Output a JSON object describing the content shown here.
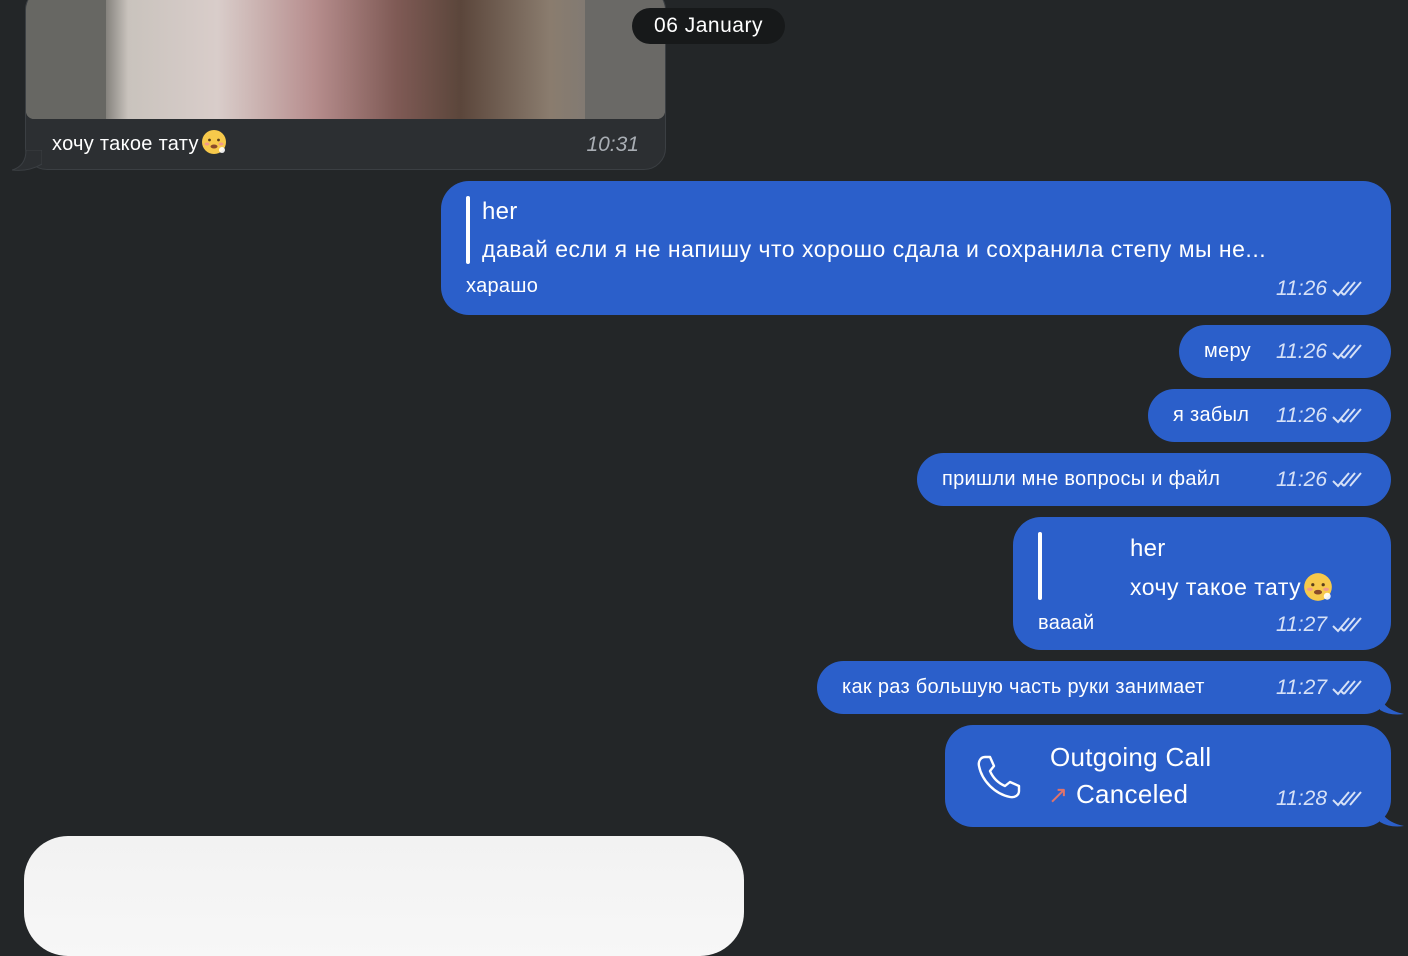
{
  "date_divider": "06 January",
  "incoming": {
    "caption": "хочу такое тату",
    "time": "10:31"
  },
  "outgoing": [
    {
      "reply_to": {
        "name": "her",
        "text": "давай если я не напишу что хорошо сдала и сохранила степу мы не..."
      },
      "text": "харашо",
      "time": "11:26"
    },
    {
      "text": "меру",
      "time": "11:26"
    },
    {
      "text": "я забыл",
      "time": "11:26"
    },
    {
      "text": "пришли мне вопросы и файл",
      "time": "11:26"
    },
    {
      "reply_to": {
        "name": "her",
        "text": "хочу такое тату"
      },
      "text": "вааай",
      "time": "11:27"
    },
    {
      "text": "как раз большую часть руки занимает",
      "time": "11:27"
    }
  ],
  "call": {
    "title": "Outgoing Call",
    "status": "Canceled",
    "status_arrow": "↗",
    "time": "11:28",
    "icon": "phone-icon"
  },
  "colors": {
    "background": "#232628",
    "outgoing_bubble": "#2b5fca",
    "incoming_bubble": "#2c2f32",
    "canceled_arrow": "#e0736b"
  }
}
